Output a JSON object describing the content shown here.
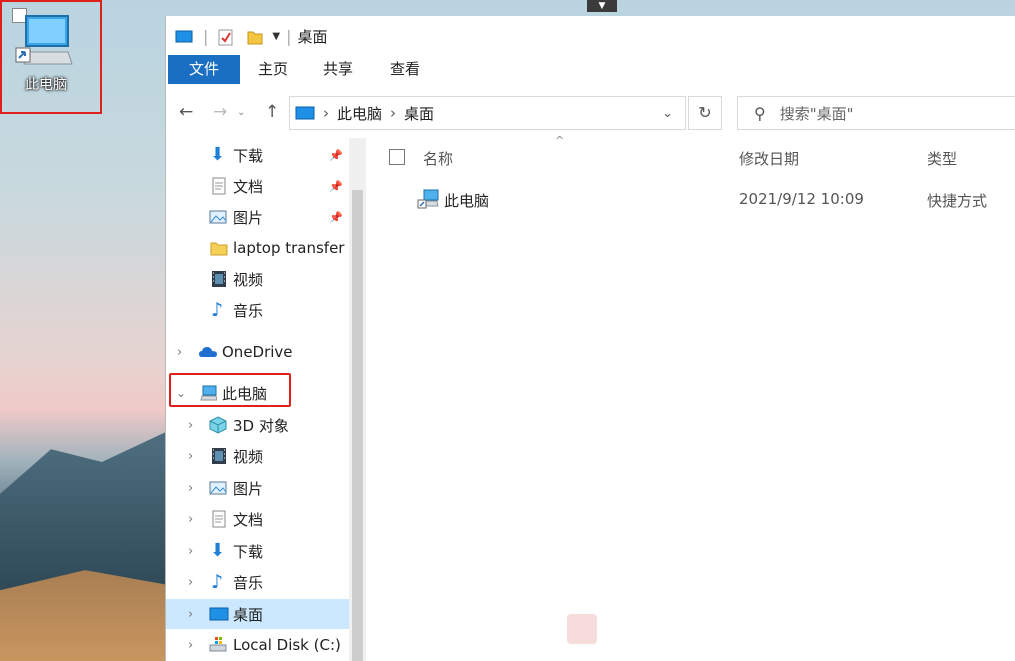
{
  "desktop": {
    "icon_label": "此电脑"
  },
  "window": {
    "title": "桌面",
    "ribbon_tabs": [
      "文件",
      "主页",
      "共享",
      "查看"
    ],
    "address": {
      "crumb1": "此电脑",
      "crumb2": "桌面"
    },
    "search_placeholder": "搜索\"桌面\""
  },
  "nav": {
    "quick": [
      {
        "label": "下载",
        "pinned": true
      },
      {
        "label": "文档",
        "pinned": true
      },
      {
        "label": "图片",
        "pinned": true
      },
      {
        "label": "laptop transfer",
        "pinned": false
      },
      {
        "label": "视频",
        "pinned": false
      },
      {
        "label": "音乐",
        "pinned": false
      }
    ],
    "onedrive": "OneDrive",
    "this_pc": "此电脑",
    "pc_children": [
      {
        "label": "3D 对象"
      },
      {
        "label": "视频"
      },
      {
        "label": "图片"
      },
      {
        "label": "文档"
      },
      {
        "label": "下载"
      },
      {
        "label": "音乐"
      },
      {
        "label": "桌面"
      },
      {
        "label": "Local Disk (C:)"
      }
    ]
  },
  "content": {
    "columns": {
      "name": "名称",
      "modified": "修改日期",
      "type": "类型"
    },
    "files": [
      {
        "name": "此电脑",
        "modified": "2021/9/12 10:09",
        "type": "快捷方式"
      }
    ]
  },
  "colors": {
    "accent": "#1a6fc2",
    "selection": "#cce8ff",
    "highlight": "#e0201b"
  }
}
